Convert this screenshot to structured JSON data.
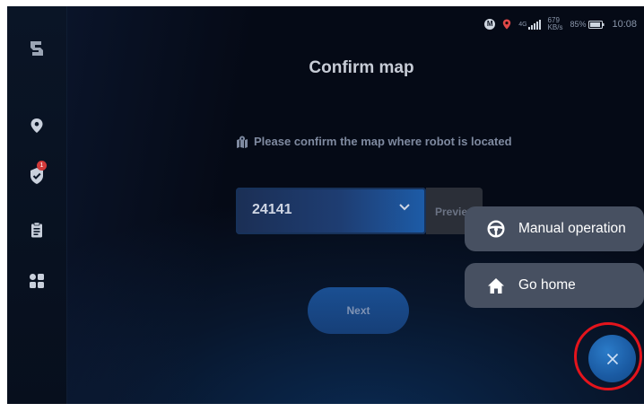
{
  "status_bar": {
    "m_label": "M",
    "network_label": "4G",
    "speed_value": "679",
    "speed_unit": "KB/s",
    "battery": "85%",
    "time": "10:08"
  },
  "sidebar": {
    "logo_icon": "app-logo",
    "items": [
      {
        "icon": "location-pin-icon"
      },
      {
        "icon": "shield-check-icon",
        "badge": "1"
      },
      {
        "icon": "clipboard-icon"
      },
      {
        "icon": "apps-grid-icon"
      }
    ]
  },
  "page": {
    "title": "Confirm map",
    "hint": "Please confirm the map where robot is located",
    "map_select_value": "24141",
    "preview_label": "Preview",
    "next_label": "Next"
  },
  "fab_menu": {
    "items": [
      {
        "label": "Manual operation",
        "icon": "steering-wheel-icon"
      },
      {
        "label": "Go home",
        "icon": "home-icon"
      }
    ],
    "close_icon": "close-icon"
  },
  "colors": {
    "background": "#050a16",
    "accent": "#1a5aa2",
    "menu_button": "#475061",
    "highlight_ring": "#e4141c",
    "badge": "#d23a3a"
  }
}
